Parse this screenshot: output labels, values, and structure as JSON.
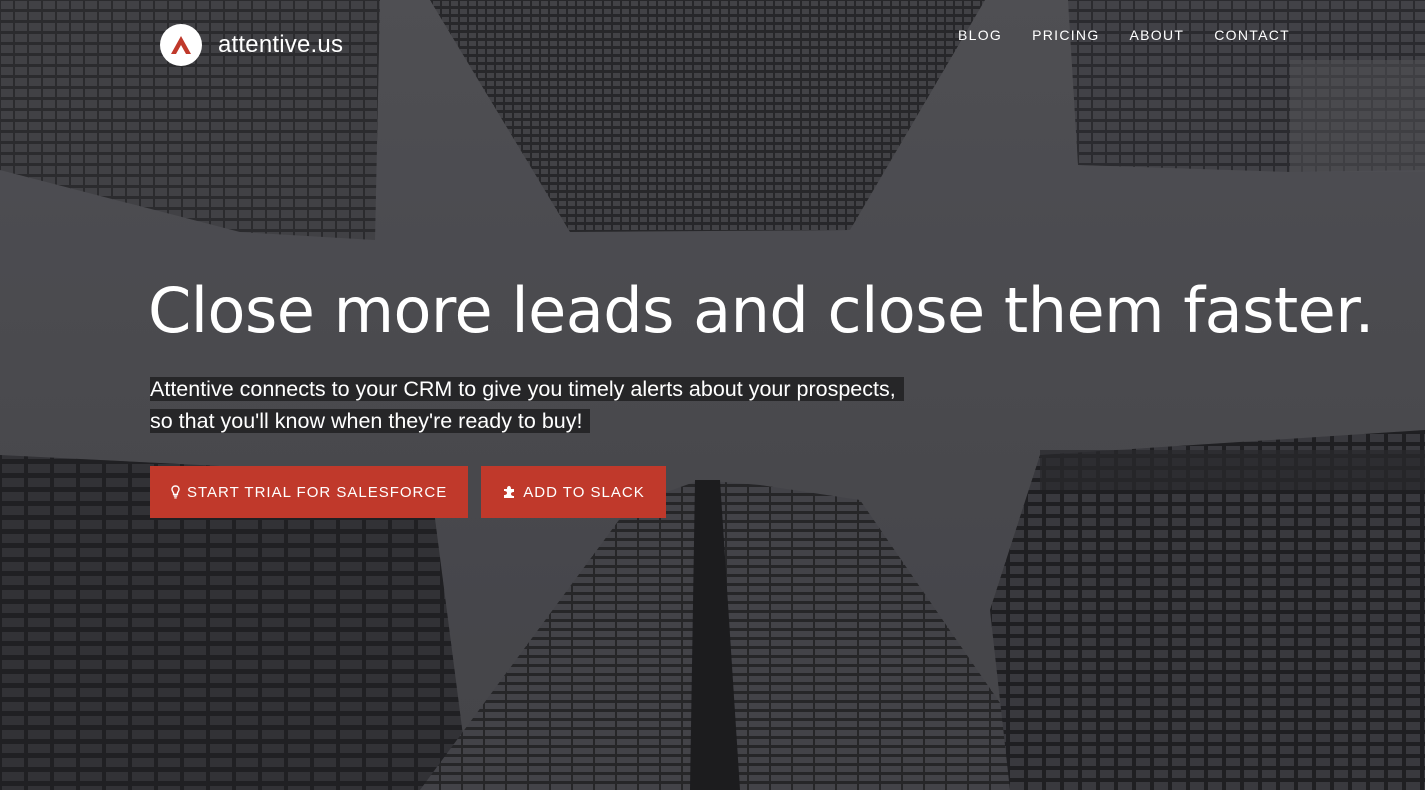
{
  "brand": {
    "name": "attentive.us",
    "logo_icon": "attentive-logo-icon",
    "accent": "#c0392b"
  },
  "nav": {
    "items": [
      {
        "label": "BLOG"
      },
      {
        "label": "PRICING"
      },
      {
        "label": "ABOUT"
      },
      {
        "label": "CONTACT"
      }
    ]
  },
  "hero": {
    "headline": "Close more leads and close them faster.",
    "sub_line_1": "Attentive connects to your CRM to give you timely alerts about your prospects,",
    "sub_line_2": "so that you'll know when they're ready to buy!",
    "buttons": [
      {
        "label": "START TRIAL FOR SALESFORCE",
        "icon": "lightbulb-icon"
      },
      {
        "label": "ADD TO SLACK",
        "icon": "puzzle-icon"
      }
    ]
  }
}
